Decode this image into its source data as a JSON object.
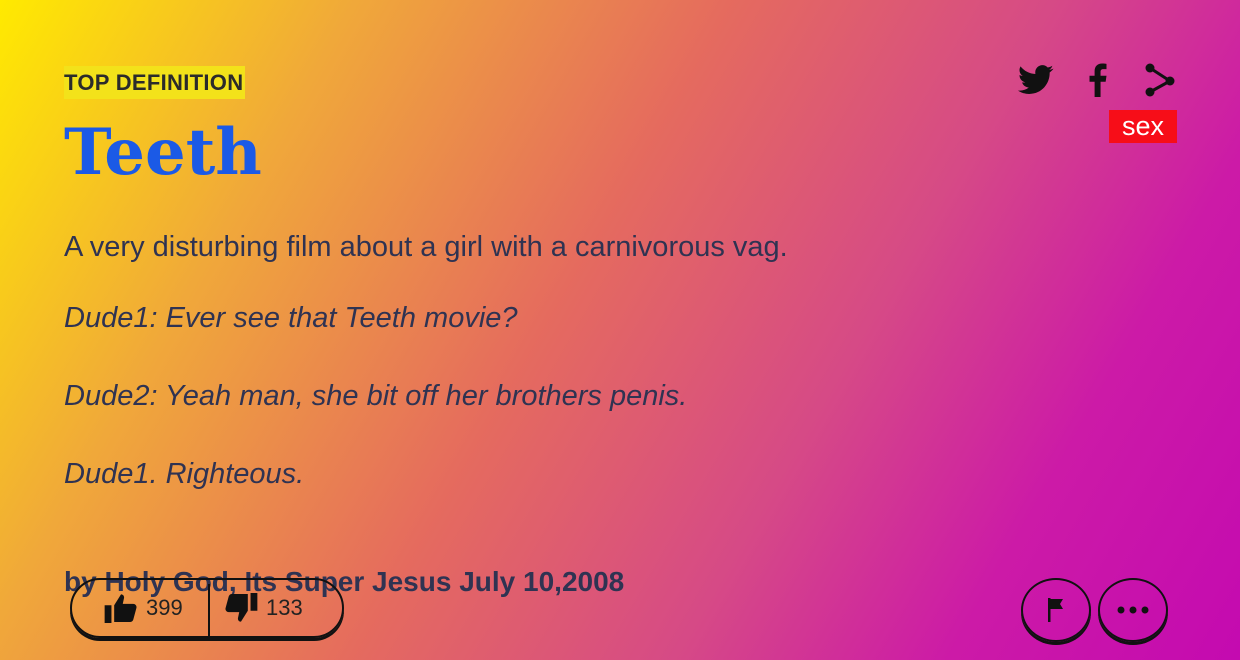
{
  "definition": {
    "section_label": "TOP DEFINITION",
    "word": "Teeth",
    "meaning": "A very disturbing film about a girl with a carnivorous vag.",
    "example_lines": [
      "Dude1: Ever see that Teeth movie?",
      "Dude2: Yeah man, she bit off her brothers penis.",
      "Dude1. Righteous."
    ],
    "author_line": "by Holy God, Its Super Jesus July 10,2008",
    "tag": "sex"
  },
  "votes": {
    "up_count": "399",
    "down_count": "133"
  },
  "icons": {
    "twitter": "twitter-icon",
    "facebook": "facebook-icon",
    "share": "share-icon",
    "thumbs_up": "thumbs-up-icon",
    "thumbs_down": "thumbs-down-icon",
    "flag": "flag-icon",
    "more": "more-icon"
  },
  "colors": {
    "word": "#1b5ae6",
    "label_highlight": "#f3e21a",
    "tag_bg": "#f70d18"
  }
}
